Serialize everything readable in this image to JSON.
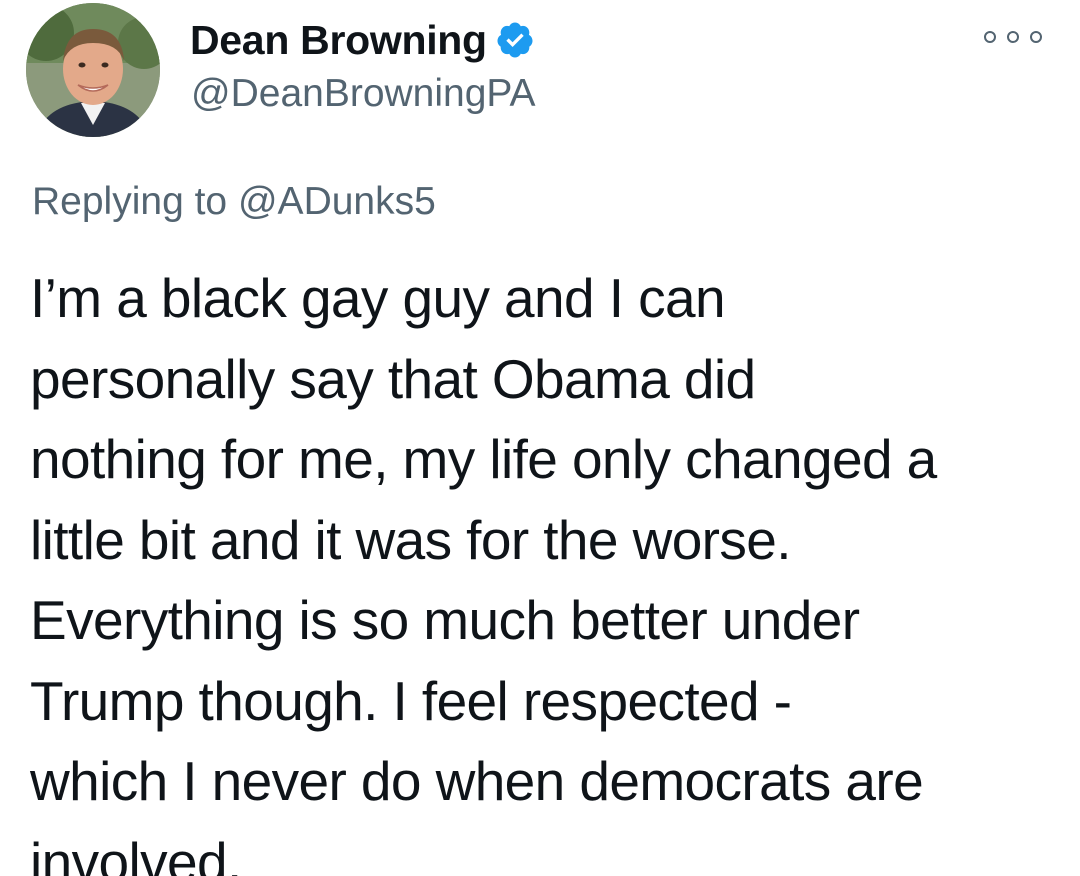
{
  "author": {
    "display_name": "Dean Browning",
    "handle": "@DeanBrowningPA",
    "verified": true
  },
  "reply": {
    "prefix": "Replying to",
    "mention": "@ADunks5"
  },
  "tweet": {
    "lines": [
      "I’m a black gay guy and I can",
      "personally say that Obama did",
      "nothing for me, my life only changed a",
      "little bit and it was for the worse.",
      "Everything is so much better under",
      "Trump though. I feel respected -",
      "which I never do when democrats are",
      "involved."
    ]
  },
  "icons": {
    "verified": "verified-badge-icon",
    "more": "more-options-icon"
  },
  "colors": {
    "verified_blue": "#1d9bf0",
    "secondary_text": "#536471",
    "primary_text": "#0f1419"
  }
}
